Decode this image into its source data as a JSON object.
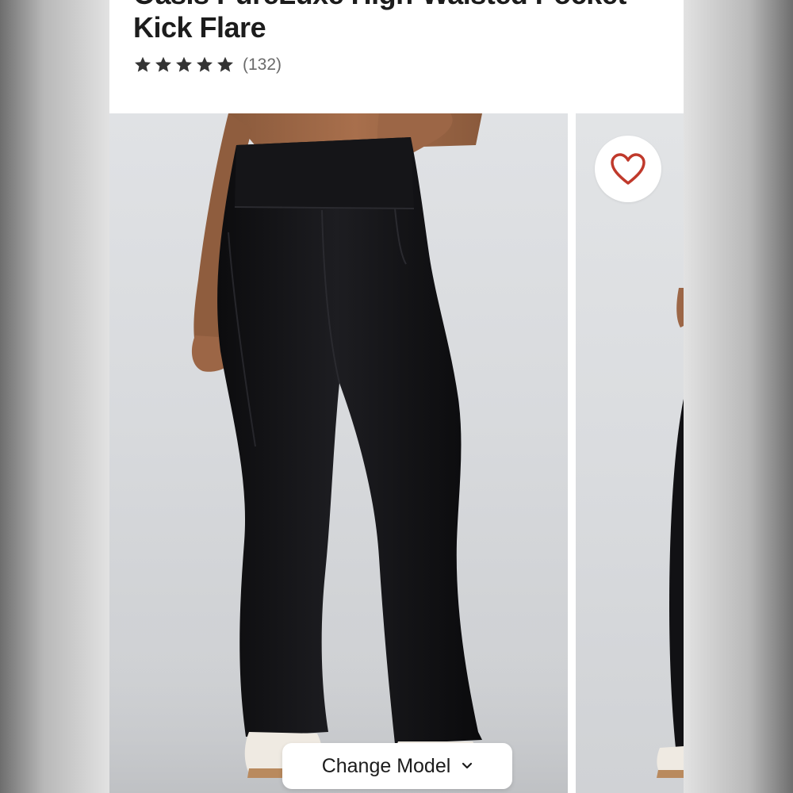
{
  "product": {
    "title_line1": "Oasis PureLuxe High-Waisted Pocket",
    "title_line2": "Kick Flare",
    "rating": 5,
    "review_count": "(132)"
  },
  "gallery": {
    "favorite_icon": "heart-icon",
    "change_model_label": "Change Model",
    "chevron_icon": "chevron-down-icon"
  },
  "colors": {
    "star": "#333333",
    "heart": "#c0392b",
    "text": "#1c1c1c",
    "muted": "#6a6a6a"
  }
}
